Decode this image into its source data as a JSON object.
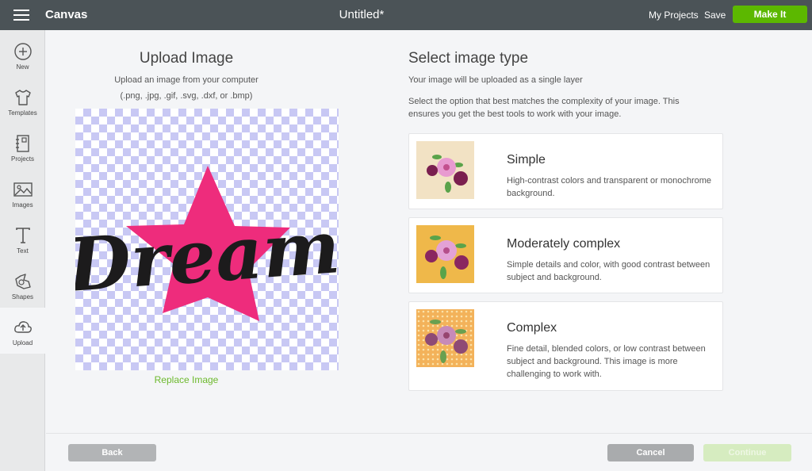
{
  "topbar": {
    "app_name": "Canvas",
    "doc_title": "Untitled*",
    "my_projects": "My Projects",
    "save": "Save",
    "make_it": "Make It"
  },
  "sidebar": {
    "items": [
      {
        "label": "New",
        "icon": "plus-circle-icon"
      },
      {
        "label": "Templates",
        "icon": "shirt-icon"
      },
      {
        "label": "Projects",
        "icon": "notebook-icon"
      },
      {
        "label": "Images",
        "icon": "image-icon"
      },
      {
        "label": "Text",
        "icon": "text-t-icon"
      },
      {
        "label": "Shapes",
        "icon": "shapes-icon"
      },
      {
        "label": "Upload",
        "icon": "cloud-upload-icon"
      }
    ],
    "active": "Upload"
  },
  "upload": {
    "title": "Upload Image",
    "subtitle_line1": "Upload an image from your computer",
    "subtitle_line2": "(.png, .jpg, .gif, .svg, .dxf, or .bmp)",
    "preview_text": "Dream",
    "replace_link": "Replace Image"
  },
  "image_type": {
    "title": "Select image type",
    "subtitle": "Your image will be uploaded as a single layer",
    "instructions": "Select the option that best matches the complexity of your image. This ensures you get the best tools to work with your image.",
    "options": [
      {
        "title": "Simple",
        "description": "High-contrast colors and transparent or monochrome background.",
        "thumb_bg": "#f2e2c4"
      },
      {
        "title": "Moderately complex",
        "description": "Simple details and color, with good contrast between subject and background.",
        "thumb_bg": "#efb84a"
      },
      {
        "title": "Complex",
        "description": "Fine detail, blended colors, or low contrast between subject and background. This image is more challenging to work with.",
        "thumb_bg": "#f3b25a"
      }
    ]
  },
  "footer": {
    "back": "Back",
    "cancel": "Cancel",
    "continue": "Continue"
  },
  "colors": {
    "topbar": "#4b5357",
    "accent_green": "#5cb800",
    "star_pink": "#ee2c7c",
    "checker": "#c8c8f4"
  }
}
